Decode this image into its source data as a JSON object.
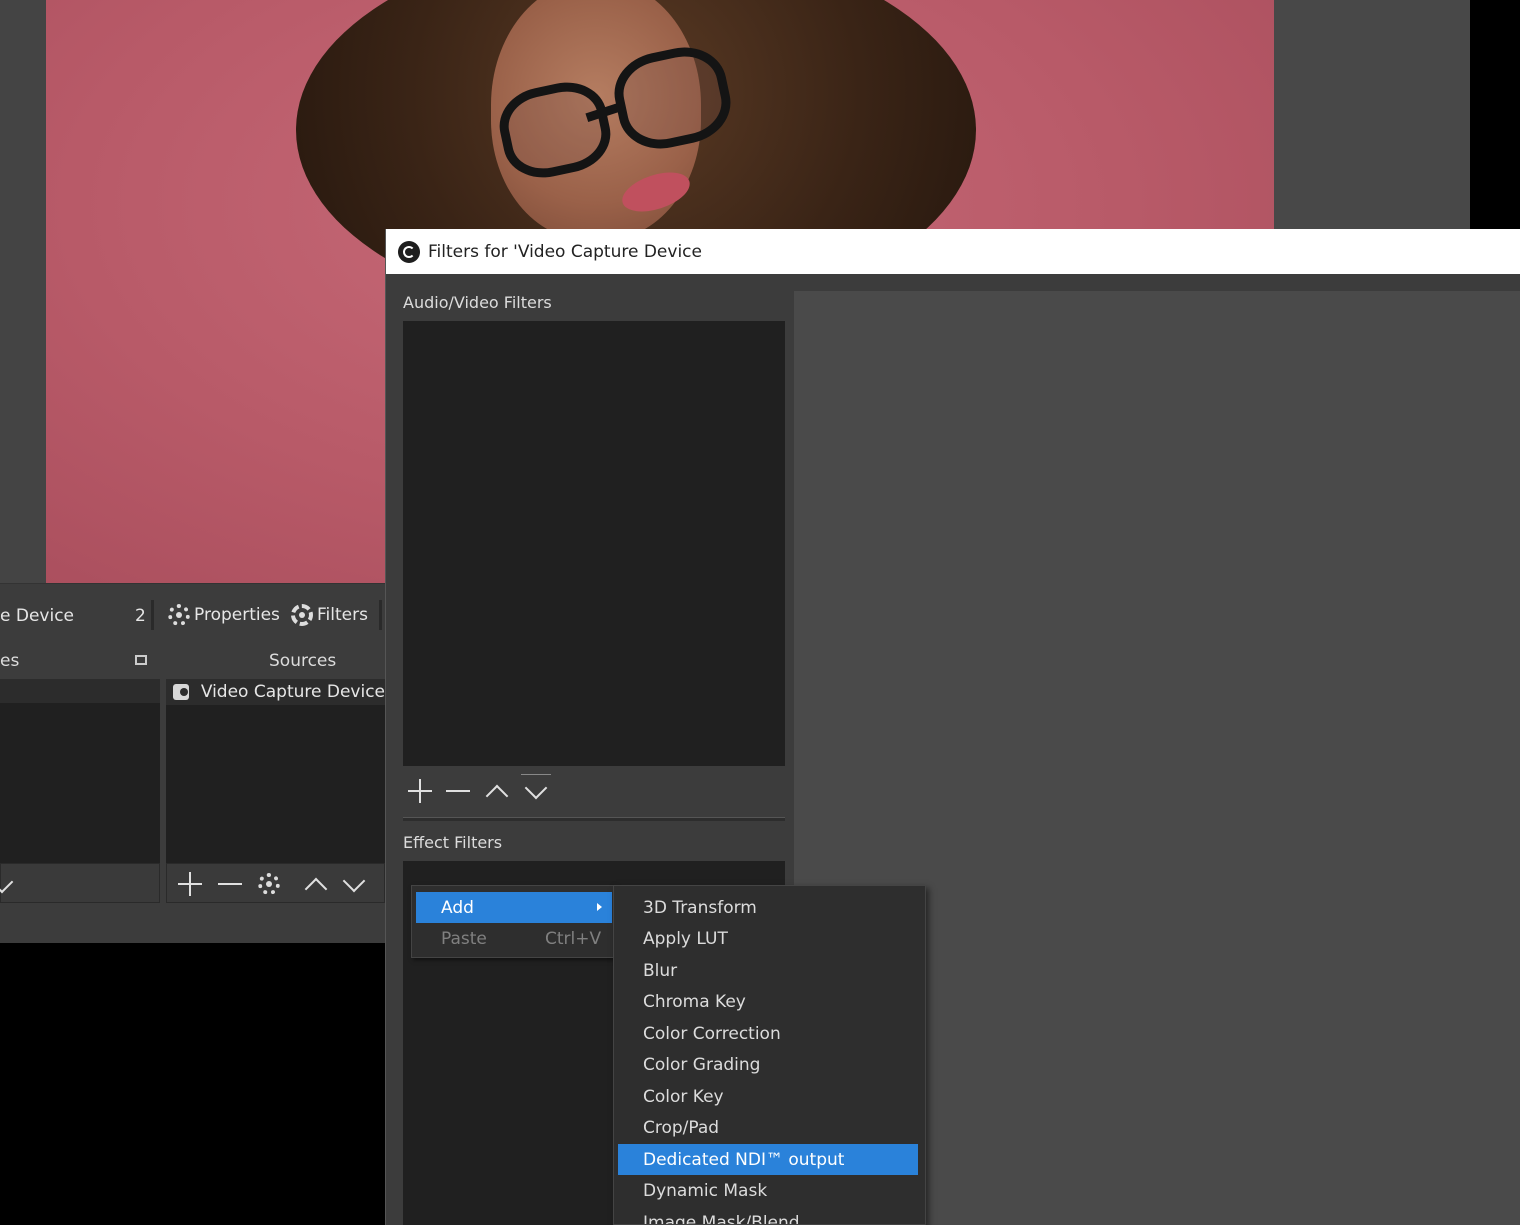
{
  "main": {
    "source_name_partial": "e Device",
    "source_count": "2",
    "properties_label": "Properties",
    "filters_label": "Filters",
    "scenes_title_partial": "es",
    "sources_title": "Sources",
    "sources": [
      {
        "label": "Video Capture Device",
        "icon": "camera-icon"
      }
    ]
  },
  "dialog": {
    "title": "Filters for 'Video Capture Device",
    "av_filters_label": "Audio/Video Filters",
    "effect_filters_label": "Effect Filters"
  },
  "context_menu": {
    "add_label": "Add",
    "paste_label": "Paste",
    "paste_shortcut": "Ctrl+V"
  },
  "filter_submenu": {
    "items": [
      "3D Transform",
      "Apply LUT",
      "Blur",
      "Chroma Key",
      "Color Correction",
      "Color Grading",
      "Color Key",
      "Crop/Pad",
      "Dedicated NDI™ output",
      "Dynamic Mask",
      "Image Mask/Blend"
    ],
    "highlighted": "Dedicated NDI™ output"
  },
  "colors": {
    "highlight": "#2a82da",
    "panel": "#3c3c3c",
    "list_bg": "#202020"
  }
}
